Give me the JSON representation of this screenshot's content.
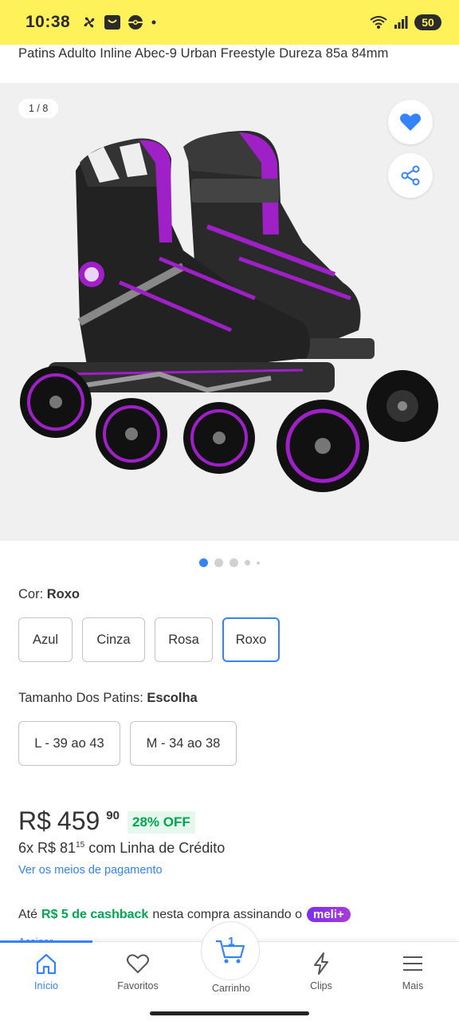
{
  "status_bar": {
    "time": "10:38",
    "battery": "50",
    "icons": [
      "fan-icon",
      "notification-icon",
      "pokeball-icon",
      "dot-icon",
      "wifi-icon",
      "signal-icon"
    ]
  },
  "product": {
    "title": "Patins Adulto Inline Abec-9 Urban Freestyle Dureza 85a 84mm"
  },
  "gallery": {
    "counter": "1 / 8",
    "dots_total": 5,
    "dots_active": 0
  },
  "color_option": {
    "label": "Cor: ",
    "value": "Roxo",
    "options": [
      "Azul",
      "Cinza",
      "Rosa",
      "Roxo"
    ],
    "selected": "Roxo"
  },
  "size_option": {
    "label": "Tamanho Dos Patins: ",
    "value": "Escolha",
    "options": [
      "L - 39 ao 43",
      "M - 34 ao 38"
    ]
  },
  "price": {
    "currency": "R$",
    "integer": "459",
    "cents": "90",
    "discount": "28% OFF",
    "installments_prefix": "6x R$ 81",
    "installments_cents": "15",
    "installments_suffix": "com Linha de Crédito",
    "payment_link": "Ver os meios de pagamento"
  },
  "cashback": {
    "prefix": "Até",
    "amount": "R$ 5 de cashback",
    "suffix": "nesta compra assinando o",
    "badge": "meli+",
    "subscribe": "Assinar"
  },
  "bottom_nav": {
    "items": [
      {
        "label": "Início",
        "icon": "home-icon"
      },
      {
        "label": "Favoritos",
        "icon": "heart-icon"
      },
      {
        "label": "Carrinho",
        "icon": "cart-icon"
      },
      {
        "label": "Clips",
        "icon": "bolt-icon"
      },
      {
        "label": "Mais",
        "icon": "menu-icon"
      }
    ],
    "cart_count": "1"
  },
  "colors": {
    "brand_yellow": "#fff159",
    "accent_blue": "#3483fa",
    "discount_green": "#00a650",
    "product_purple": "#a020c8"
  }
}
